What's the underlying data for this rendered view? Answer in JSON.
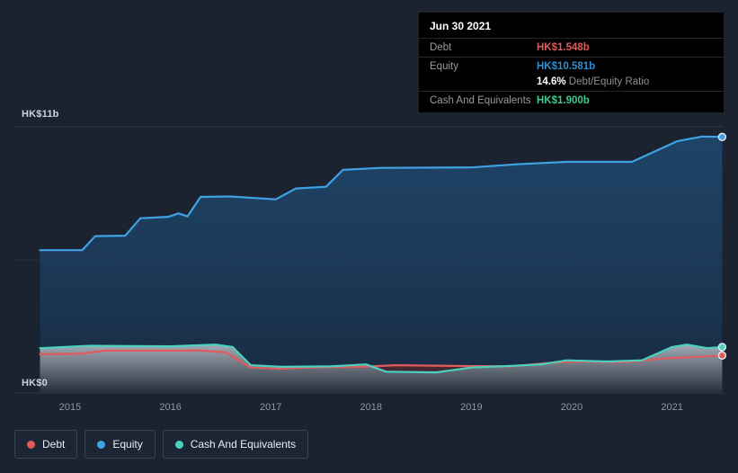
{
  "tooltip": {
    "date": "Jun 30 2021",
    "debt_label": "Debt",
    "debt_value": "HK$1.548b",
    "equity_label": "Equity",
    "equity_value": "HK$10.581b",
    "ratio_value": "14.6%",
    "ratio_label": " Debt/Equity Ratio",
    "cash_label": "Cash And Equivalents",
    "cash_value": "HK$1.900b"
  },
  "axis": {
    "y_top": "HK$11b",
    "y_bottom": "HK$0"
  },
  "legend": {
    "debt": "Debt",
    "equity": "Equity",
    "cash": "Cash And Equivalents"
  },
  "colors": {
    "background": "#1b2330",
    "debt": "#e05b5b",
    "equity": "#3fa2e4",
    "equity_value": "#2f8fd0",
    "cash": "#4ad2bf",
    "cash_value": "#3ecb8d",
    "grid": "#2e3a4a"
  },
  "chart_data": {
    "type": "area",
    "x_ticks": [
      "2015",
      "2016",
      "2017",
      "2018",
      "2019",
      "2020",
      "2021"
    ],
    "x_range": [
      2014.7,
      2021.55
    ],
    "ylim": [
      0,
      11
    ],
    "y_gridlines": [
      0,
      5.5,
      11
    ],
    "y_unit": "HK$ billions",
    "legend_position": "bottom-left",
    "series": [
      {
        "name": "Equity",
        "color": "#3fa2e4",
        "gradient": "equity-fill",
        "points": [
          [
            2014.7,
            5.9
          ],
          [
            2015.12,
            5.9
          ],
          [
            2015.25,
            6.48
          ],
          [
            2015.55,
            6.5
          ],
          [
            2015.7,
            7.22
          ],
          [
            2015.98,
            7.28
          ],
          [
            2016.08,
            7.42
          ],
          [
            2016.17,
            7.3
          ],
          [
            2016.3,
            8.1
          ],
          [
            2016.6,
            8.12
          ],
          [
            2017.05,
            8.0
          ],
          [
            2017.25,
            8.45
          ],
          [
            2017.55,
            8.52
          ],
          [
            2017.72,
            9.22
          ],
          [
            2018.1,
            9.3
          ],
          [
            2019.0,
            9.32
          ],
          [
            2019.45,
            9.45
          ],
          [
            2019.95,
            9.55
          ],
          [
            2020.6,
            9.55
          ],
          [
            2021.05,
            10.4
          ],
          [
            2021.3,
            10.6
          ],
          [
            2021.5,
            10.581
          ]
        ]
      },
      {
        "name": "Debt",
        "color": "#e05b5b",
        "gradient": "debt-fill",
        "points": [
          [
            2014.7,
            1.6
          ],
          [
            2015.1,
            1.62
          ],
          [
            2015.35,
            1.75
          ],
          [
            2016.3,
            1.75
          ],
          [
            2016.55,
            1.68
          ],
          [
            2016.8,
            1.05
          ],
          [
            2017.1,
            1.0
          ],
          [
            2017.4,
            1.06
          ],
          [
            2017.9,
            1.08
          ],
          [
            2018.25,
            1.15
          ],
          [
            2018.8,
            1.12
          ],
          [
            2019.4,
            1.1
          ],
          [
            2019.8,
            1.25
          ],
          [
            2020.05,
            1.3
          ],
          [
            2020.55,
            1.28
          ],
          [
            2020.9,
            1.42
          ],
          [
            2021.2,
            1.48
          ],
          [
            2021.5,
            1.548
          ]
        ]
      },
      {
        "name": "Cash And Equivalents",
        "color": "#4ad2bf",
        "gradient": "cash-fill",
        "points": [
          [
            2014.7,
            1.85
          ],
          [
            2015.2,
            1.95
          ],
          [
            2016.0,
            1.93
          ],
          [
            2016.45,
            2.0
          ],
          [
            2016.62,
            1.9
          ],
          [
            2016.8,
            1.15
          ],
          [
            2017.1,
            1.08
          ],
          [
            2017.6,
            1.1
          ],
          [
            2017.95,
            1.18
          ],
          [
            2018.15,
            0.88
          ],
          [
            2018.65,
            0.85
          ],
          [
            2019.0,
            1.05
          ],
          [
            2019.4,
            1.12
          ],
          [
            2019.7,
            1.18
          ],
          [
            2019.95,
            1.35
          ],
          [
            2020.35,
            1.3
          ],
          [
            2020.7,
            1.35
          ],
          [
            2021.0,
            1.9
          ],
          [
            2021.15,
            2.0
          ],
          [
            2021.35,
            1.85
          ],
          [
            2021.5,
            1.9
          ]
        ]
      }
    ]
  }
}
